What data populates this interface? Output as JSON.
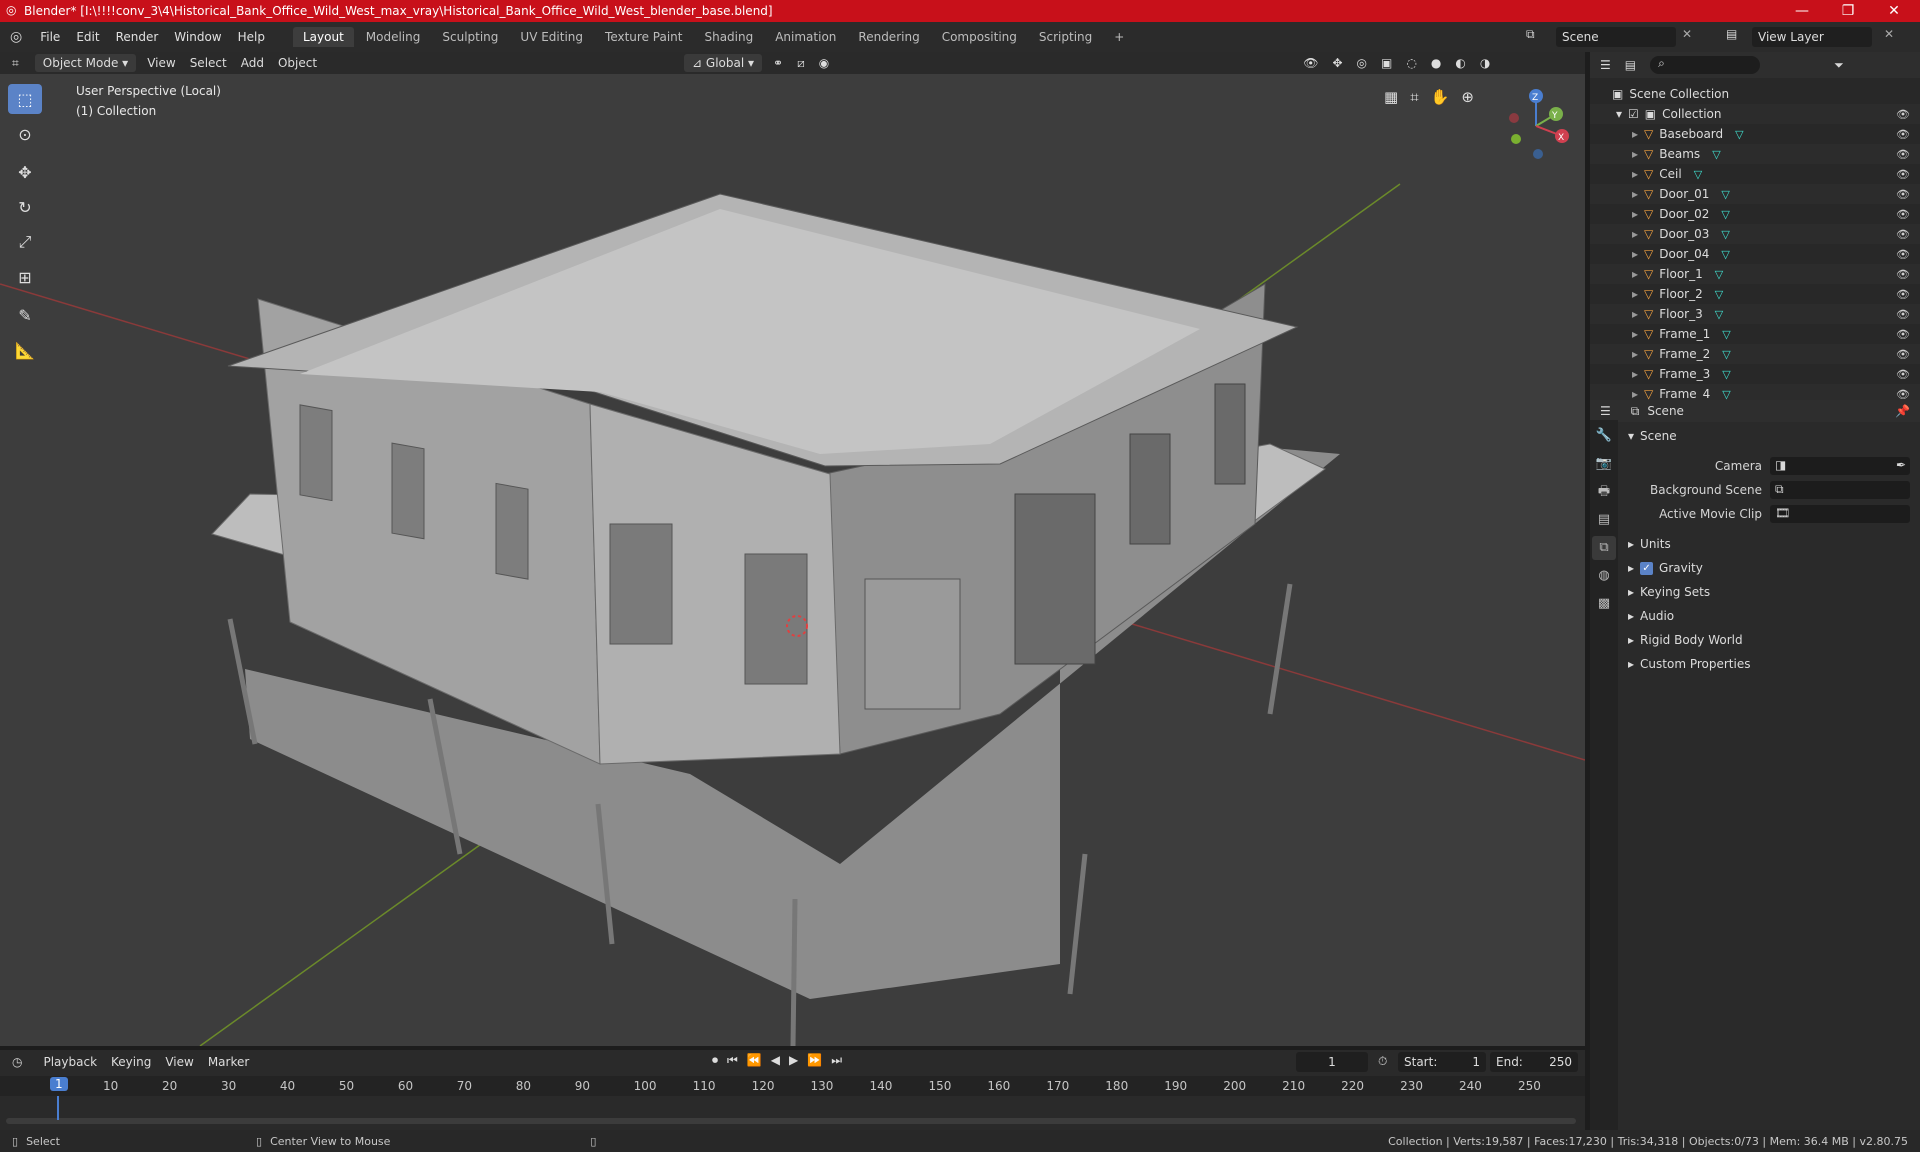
{
  "window": {
    "title": "Blender* [I:\\!!!!conv_3\\4\\Historical_Bank_Office_Wild_West_max_vray\\Historical_Bank_Office_Wild_West_blender_base.blend]",
    "minimize": "—",
    "maximize": "❐",
    "close": "✕"
  },
  "menu": [
    "File",
    "Edit",
    "Render",
    "Window",
    "Help"
  ],
  "workspaces": [
    "Layout",
    "Modeling",
    "Sculpting",
    "UV Editing",
    "Texture Paint",
    "Shading",
    "Animation",
    "Rendering",
    "Compositing",
    "Scripting"
  ],
  "add_workspace": "+",
  "scene_field": "Scene",
  "view_layer_field": "View Layer",
  "viewport_header": {
    "mode": "Object Mode",
    "menus": [
      "View",
      "Select",
      "Add",
      "Object"
    ],
    "transform": "Global"
  },
  "viewport": {
    "perspective": "User Perspective (Local)",
    "collection": "(1) Collection",
    "gizmo": {
      "x": "X",
      "y": "Y",
      "z": "Z"
    }
  },
  "outliner": {
    "root": "Scene Collection",
    "collection": "Collection",
    "items": [
      "Baseboard",
      "Beams",
      "Ceil",
      "Door_01",
      "Door_02",
      "Door_03",
      "Door_04",
      "Floor_1",
      "Floor_2",
      "Floor_3",
      "Frame_1",
      "Frame_2",
      "Frame_3",
      "Frame_4"
    ]
  },
  "properties": {
    "header": "Scene",
    "section": "Scene",
    "fields": [
      {
        "label": "Camera"
      },
      {
        "label": "Background Scene"
      },
      {
        "label": "Active Movie Clip"
      }
    ],
    "subsections": [
      "Units",
      "Gravity",
      "Keying Sets",
      "Audio",
      "Rigid Body World",
      "Custom Properties"
    ]
  },
  "timeline": {
    "menus": [
      "Playback",
      "Keying",
      "View",
      "Marker"
    ],
    "current_frame": "1",
    "start_label": "Start:",
    "start": "1",
    "end_label": "End:",
    "end": "250",
    "ticks": [
      "1",
      "10",
      "20",
      "30",
      "40",
      "50",
      "60",
      "70",
      "80",
      "90",
      "100",
      "110",
      "120",
      "130",
      "140",
      "150",
      "160",
      "170",
      "180",
      "190",
      "200",
      "210",
      "220",
      "230",
      "240",
      "250"
    ]
  },
  "status": {
    "left": "Select",
    "middle": "Center View to Mouse",
    "right": "Collection | Verts:19,587 | Faces:17,230 | Tris:34,318 | Objects:0/73 | Mem: 36.4 MB | v2.80.75"
  },
  "colors": {
    "accent": "#5b83c7",
    "titlebar": "#c8101a",
    "mesh_icon": "#40e0d0",
    "object_icon": "#f0a040"
  }
}
